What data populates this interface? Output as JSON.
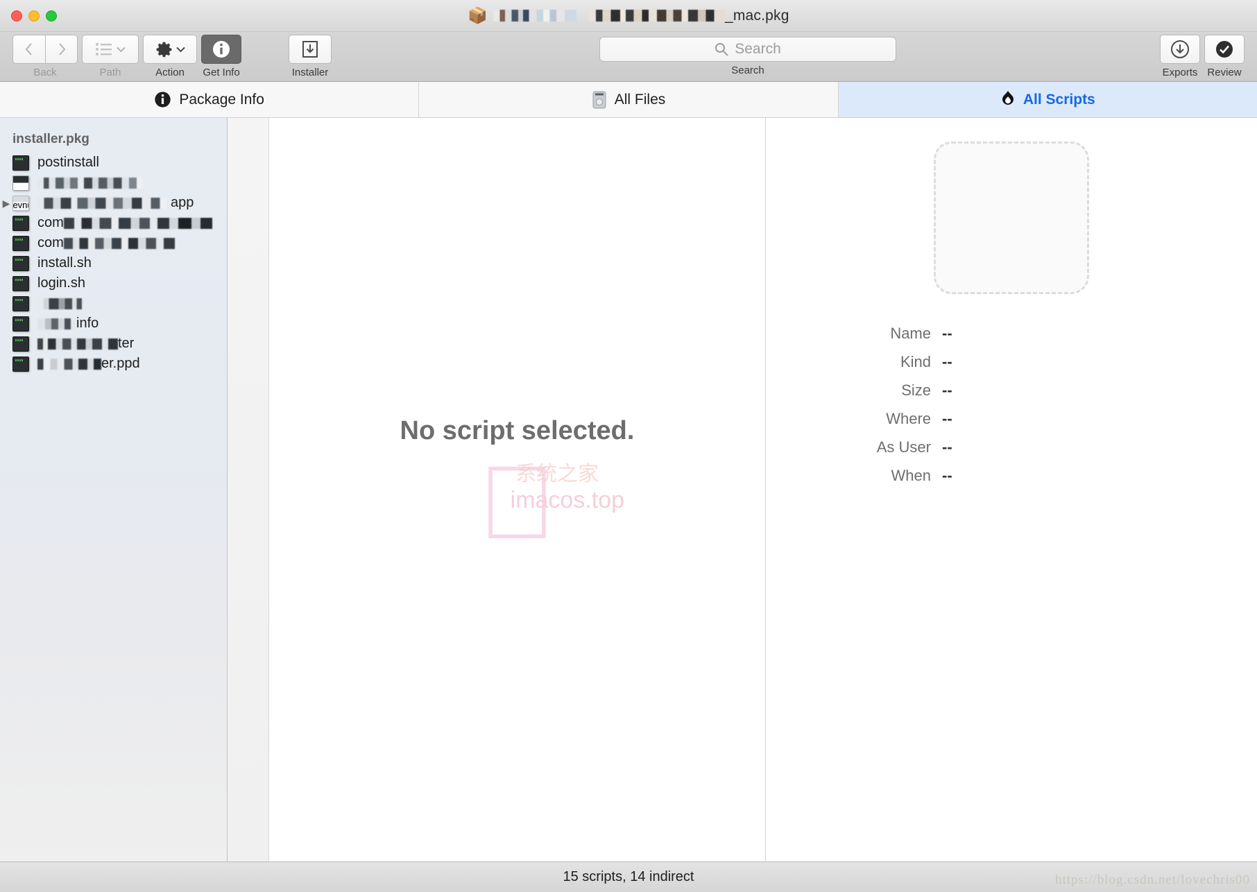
{
  "window": {
    "title_suffix": "_mac.pkg",
    "title_icon": "package-box-icon",
    "traffic_lights": [
      "close",
      "minimize",
      "maximize"
    ]
  },
  "toolbar": {
    "back_label": "Back",
    "path_label": "Path",
    "action_label": "Action",
    "getinfo_label": "Get Info",
    "installer_label": "Installer",
    "search_label": "Search",
    "search_placeholder": "Search",
    "search_value": "",
    "exports_label": "Exports",
    "review_label": "Review"
  },
  "tabs": [
    {
      "label": "Package Info",
      "icon": "info-circle-icon",
      "active": false
    },
    {
      "label": "All Files",
      "icon": "hard-drive-icon",
      "active": false
    },
    {
      "label": "All Scripts",
      "icon": "script-flame-icon",
      "active": true
    }
  ],
  "sidebar": {
    "root": "installer.pkg",
    "items": [
      {
        "label": "postinstall",
        "icon": "script-icon",
        "redacted": "none",
        "expandable": false
      },
      {
        "label": "",
        "icon": "document-icon",
        "redacted": "r1",
        "expandable": false
      },
      {
        "label": "app",
        "icon": "app-icon",
        "redacted": "r2",
        "expandable": true
      },
      {
        "label": "com",
        "icon": "script-icon",
        "redacted": "r3",
        "expandable": false
      },
      {
        "label": "com",
        "icon": "script-icon",
        "redacted": "r4",
        "expandable": false
      },
      {
        "label": "install.sh",
        "icon": "script-icon",
        "redacted": "none",
        "expandable": false
      },
      {
        "label": "login.sh",
        "icon": "script-icon",
        "redacted": "none",
        "expandable": false
      },
      {
        "label": "",
        "icon": "script-icon",
        "redacted": "r5",
        "expandable": false
      },
      {
        "label": "info",
        "icon": "script-icon",
        "redacted": "r6",
        "expandable": false
      },
      {
        "label": "ter",
        "icon": "script-icon",
        "redacted": "r7",
        "expandable": false
      },
      {
        "label": "er.ppd",
        "icon": "script-icon",
        "redacted": "r8",
        "expandable": false
      }
    ]
  },
  "center": {
    "empty_message": "No script selected.",
    "watermark_apple": "",
    "watermark_site": "imacos.top",
    "watermark_cjk": "系统之家"
  },
  "inspector": {
    "dropzone_name": "script-dropzone",
    "fields": [
      {
        "label": "Name",
        "value": "--"
      },
      {
        "label": "Kind",
        "value": "--"
      },
      {
        "label": "Size",
        "value": "--"
      },
      {
        "label": "Where",
        "value": "--"
      },
      {
        "label": "As User",
        "value": "--"
      },
      {
        "label": "When",
        "value": "--"
      }
    ]
  },
  "statusbar": {
    "text": "15 scripts, 14 indirect",
    "blog_watermark": "https://blog.csdn.net/lovechris00"
  },
  "colors": {
    "accent": "#1569e0",
    "tab_active_bg": "#dce9fb",
    "sidebar_bg": "#e7ebf2",
    "toolbar_bg": "#d2d2d2"
  }
}
